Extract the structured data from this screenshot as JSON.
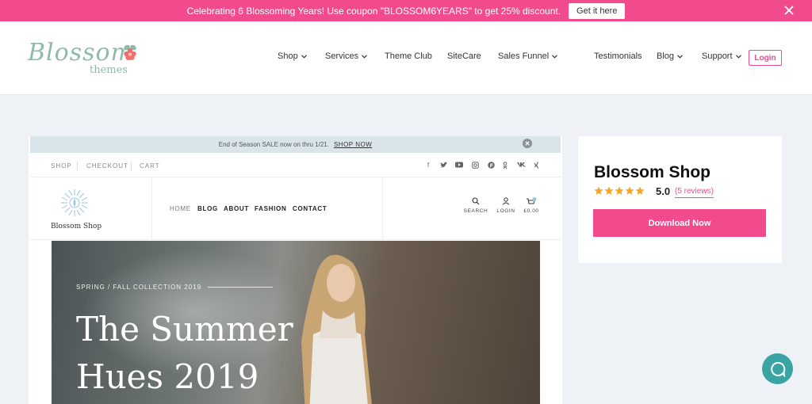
{
  "promo": {
    "message": "Celebrating 6 Blossoming Years! Use coupon \"BLOSSOM6YEARS\" to get 25% discount.",
    "cta": "Get it here"
  },
  "header": {
    "logo_text": "Blossom",
    "logo_sub": "themes",
    "nav": [
      {
        "label": "Shop",
        "dropdown": true
      },
      {
        "label": "Services",
        "dropdown": true
      },
      {
        "label": "Theme Club",
        "dropdown": false
      },
      {
        "label": "SiteCare",
        "dropdown": false
      },
      {
        "label": "Sales Funnel",
        "dropdown": true
      },
      {
        "label": "Testimonials",
        "dropdown": false
      },
      {
        "label": "Blog",
        "dropdown": true
      },
      {
        "label": "Support",
        "dropdown": true
      }
    ],
    "login": "Login"
  },
  "preview": {
    "sale_text": "End of Season SALE now on thru 1/21.",
    "sale_link": "SHOP NOW",
    "top_links": [
      "SHOP",
      "CHECKOUT",
      "CART"
    ],
    "social_icons": [
      "facebook-icon",
      "twitter-icon",
      "youtube-icon",
      "instagram-icon",
      "pinterest-icon",
      "odnoklassniki-icon",
      "vk-icon",
      "xing-icon"
    ],
    "logo_text": "Blossom Shop",
    "menu": [
      "HOME",
      "BLOG",
      "ABOUT",
      "FASHION",
      "CONTACT"
    ],
    "tools": {
      "search": "SEARCH",
      "login": "LOGIN",
      "cart": "£0.00",
      "cart_count": "0"
    },
    "hero": {
      "kicker": "SPRING / FALL COLLECTION 2019",
      "title_line1": "The Summer",
      "title_line2": "Hues 2019"
    }
  },
  "product": {
    "name": "Blossom Shop",
    "rating": "5.0",
    "stars": 5,
    "reviews": "(5 reviews)",
    "download": "Download Now"
  },
  "colors": {
    "accent": "#f24b8d",
    "star": "#f5a623",
    "chat": "#3aa3a3"
  }
}
